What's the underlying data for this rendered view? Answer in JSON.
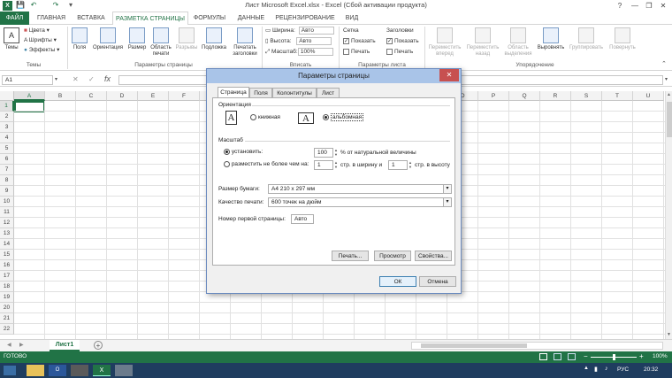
{
  "window": {
    "title": "Лист Microsoft Excel.xlsx - Excel (Сбой активации продукта)",
    "controls": [
      "?",
      "—",
      "❐",
      "✕"
    ]
  },
  "ribbon_tabs": {
    "file": "ФАЙЛ",
    "tabs": [
      "ГЛАВНАЯ",
      "ВСТАВКА",
      "РАЗМЕТКА СТРАНИЦЫ",
      "ФОРМУЛЫ",
      "ДАННЫЕ",
      "РЕЦЕНЗИРОВАНИЕ",
      "ВИД"
    ],
    "active": "РАЗМЕТКА СТРАНИЦЫ"
  },
  "ribbon": {
    "themes": {
      "big": "Темы",
      "small": [
        "Цвета",
        "Шрифты",
        "Эффекты"
      ],
      "group": "Темы"
    },
    "page_setup": {
      "buttons": [
        "Поля",
        "Ориентация",
        "Размер",
        "Область печати",
        "Разрывы",
        "Подложка",
        "Печатать заголовки"
      ],
      "group": "Параметры страницы"
    },
    "fit": {
      "rows": [
        {
          "label": "Ширина:",
          "value": "Авто"
        },
        {
          "label": "Высота:",
          "value": "Авто"
        },
        {
          "label": "Масштаб:",
          "value": "100%"
        }
      ],
      "group": "Вписать"
    },
    "sheet_options": {
      "col1_title": "Сетка",
      "col2_title": "Заголовки",
      "view": "Показать",
      "print": "Печать",
      "group": "Параметры листа"
    },
    "arrange": {
      "buttons": [
        "Переместить вперед",
        "Переместить назад",
        "Область выделения",
        "Выровнять",
        "Группировать",
        "Повернуть"
      ],
      "group": "Упорядочение"
    }
  },
  "formula_bar": {
    "name_box": "A1",
    "fx": "fx",
    "cancel": "✕",
    "enter": "✓"
  },
  "grid": {
    "columns": [
      "A",
      "B",
      "C",
      "D",
      "E",
      "F",
      "G",
      "H",
      "I",
      "J",
      "K",
      "L",
      "M",
      "N",
      "O",
      "P",
      "Q",
      "R",
      "S",
      "T",
      "U"
    ],
    "rows": [
      "1",
      "2",
      "3",
      "4",
      "5",
      "6",
      "7",
      "8",
      "9",
      "10",
      "11",
      "12",
      "13",
      "14",
      "15",
      "16",
      "17",
      "18",
      "19",
      "20",
      "21",
      "22"
    ]
  },
  "sheet_tabs": {
    "active": "Лист1",
    "add": "+"
  },
  "status": {
    "ready": "ГОТОВО",
    "zoom": "100%",
    "zoom_minus": "−",
    "zoom_plus": "+"
  },
  "taskbar": {
    "lang": "РУС",
    "time": "20:32"
  },
  "dialog": {
    "title": "Параметры страницы",
    "tabs": [
      "Страница",
      "Поля",
      "Колонтитулы",
      "Лист"
    ],
    "active_tab": "Страница",
    "orientation": {
      "heading": "Ориентация",
      "portrait": "книжная",
      "landscape": "альбомная",
      "selected": "альбомная",
      "icon_letter": "A"
    },
    "scaling": {
      "heading": "Масштаб",
      "set_label": "установить:",
      "set_value": "100",
      "set_suffix": "% от натуральной величины",
      "fit_label": "разместить не более чем на:",
      "fit_wide": "1",
      "fit_wide_suffix": "стр. в ширину и",
      "fit_tall": "1",
      "fit_tall_suffix": "стр. в высоту",
      "selected": "установить"
    },
    "paper_size": {
      "label": "Размер бумаги:",
      "value": "А4 210 x 297 мм"
    },
    "print_quality": {
      "label": "Качество печати:",
      "value": "600 точек на дюйм"
    },
    "first_page": {
      "label": "Номер первой страницы:",
      "value": "Авто"
    },
    "buttons": {
      "print": "Печать...",
      "preview": "Просмотр",
      "properties": "Свойства...",
      "ok": "ОК",
      "cancel": "Отмена"
    }
  },
  "colors": {
    "excel_green": "#217346",
    "taskbar": "#1f3d5f",
    "dialog_title": "#a9c4e8",
    "close_red": "#c75050"
  }
}
